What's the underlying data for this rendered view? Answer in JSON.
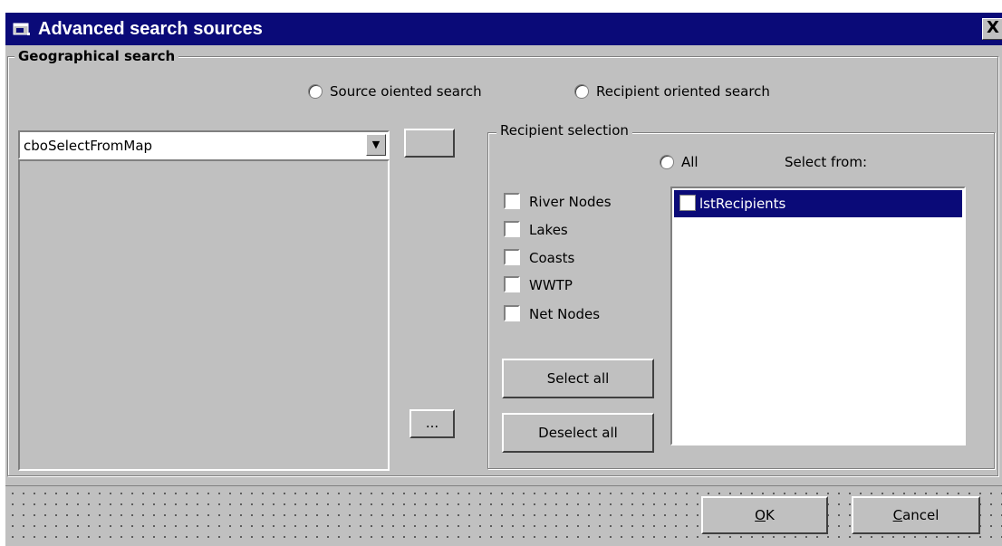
{
  "window": {
    "title": "Advanced search sources",
    "close_label": "X"
  },
  "geo_group": {
    "label": "Geographical search",
    "radio_source": "Source oiented search",
    "radio_recipient": "Recipient oriented search"
  },
  "map_panel": {
    "combo_value": "cboSelectFromMap",
    "top_button_label": "",
    "browse_button_label": "..."
  },
  "recipient_group": {
    "label": "Recipient selection",
    "radio_all": "All",
    "select_from_label": "Select from:",
    "checkboxes": [
      "River Nodes",
      "Lakes",
      "Coasts",
      "WWTP",
      "Net Nodes"
    ],
    "select_all_label": "Select all",
    "deselect_all_label": "Deselect all",
    "list_items": [
      "lstRecipients"
    ]
  },
  "footer": {
    "ok_mnemonic": "O",
    "ok_rest": "K",
    "cancel_mnemonic": "C",
    "cancel_rest": "ancel"
  },
  "colors": {
    "title_bar": "#0a0a78",
    "dialog_face": "#c0c0c0",
    "selection": "#0a0a78"
  }
}
